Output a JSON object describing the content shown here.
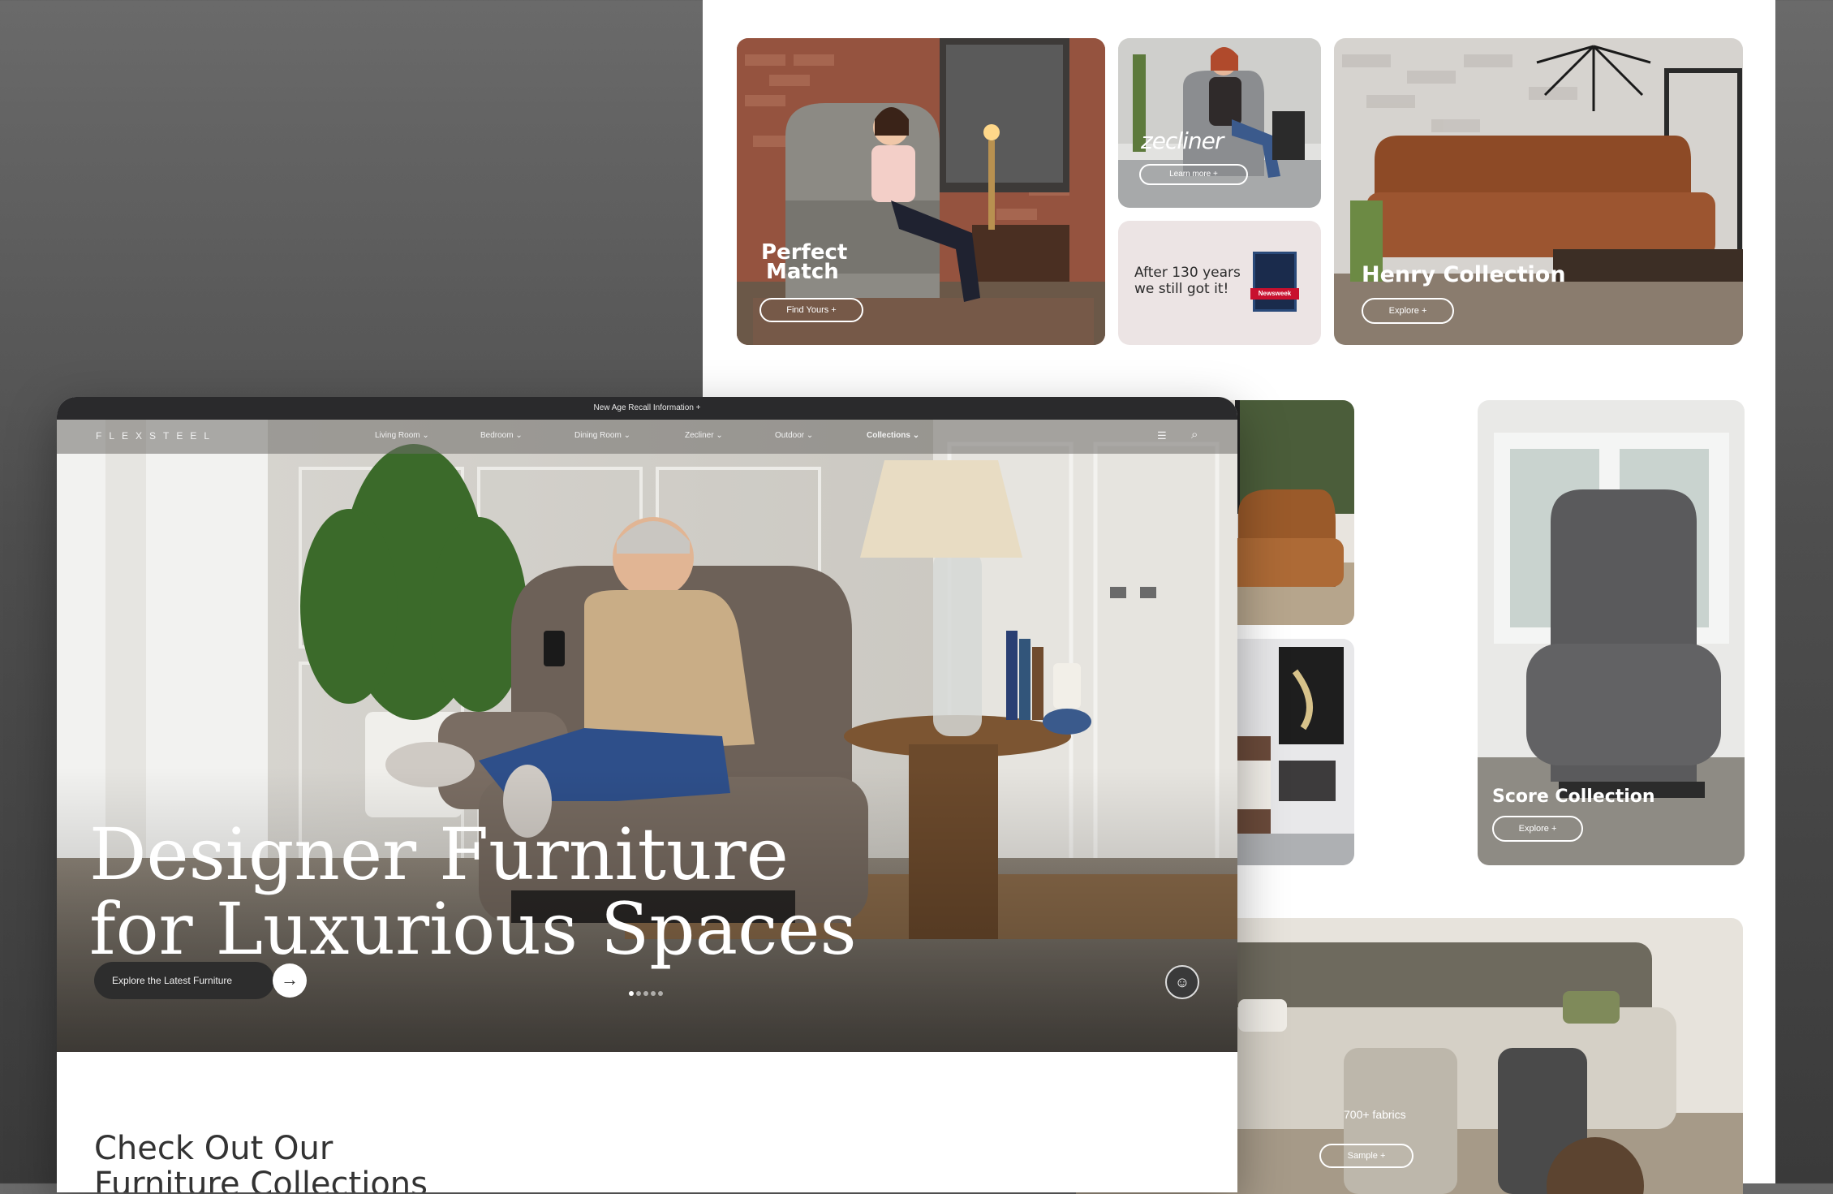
{
  "colors": {
    "background": "#555555",
    "announce_bar": "#2a2a2c",
    "cta_bg": "#2d2d2d",
    "card_pink": "#ece4e4",
    "badge_red": "#c8102e",
    "badge_navy": "#1a2b4c"
  },
  "background_page": {
    "cards": [
      {
        "title_line1": "Perfect",
        "title_line2": "Match",
        "button": "Find Yours +"
      },
      {
        "logo": "zecliner",
        "button": "Learn more +"
      },
      {
        "text_line1": "After 130 years",
        "text_line2": "we still got it!",
        "badge": "Newsweek"
      },
      {
        "title": "Henry Collection",
        "button": "Explore +"
      },
      {
        "title": "Score Collection",
        "button": "Explore +"
      },
      {
        "caption": "700+ fabrics",
        "button": "Sample +"
      }
    ]
  },
  "main": {
    "announcement": "New Age Recall Information +",
    "brand": "FLEXSTEEL",
    "nav": {
      "items": [
        "Living Room",
        "Bedroom",
        "Dining Room",
        "Zecliner",
        "Outdoor",
        "Collections"
      ],
      "chevron": "⌄",
      "menu_icon": "☰",
      "search_icon": "⌕"
    },
    "hero": {
      "headline_line1": "Designer Furniture",
      "headline_line2": "for Luxurious Spaces",
      "cta_label": "Explore the Latest Furniture",
      "cta_arrow": "→",
      "chat_icon": "☺",
      "slide_count": 5,
      "active_slide": 1
    },
    "section_title_line1": "Check Out Our",
    "section_title_line2": "Furniture Collections"
  }
}
